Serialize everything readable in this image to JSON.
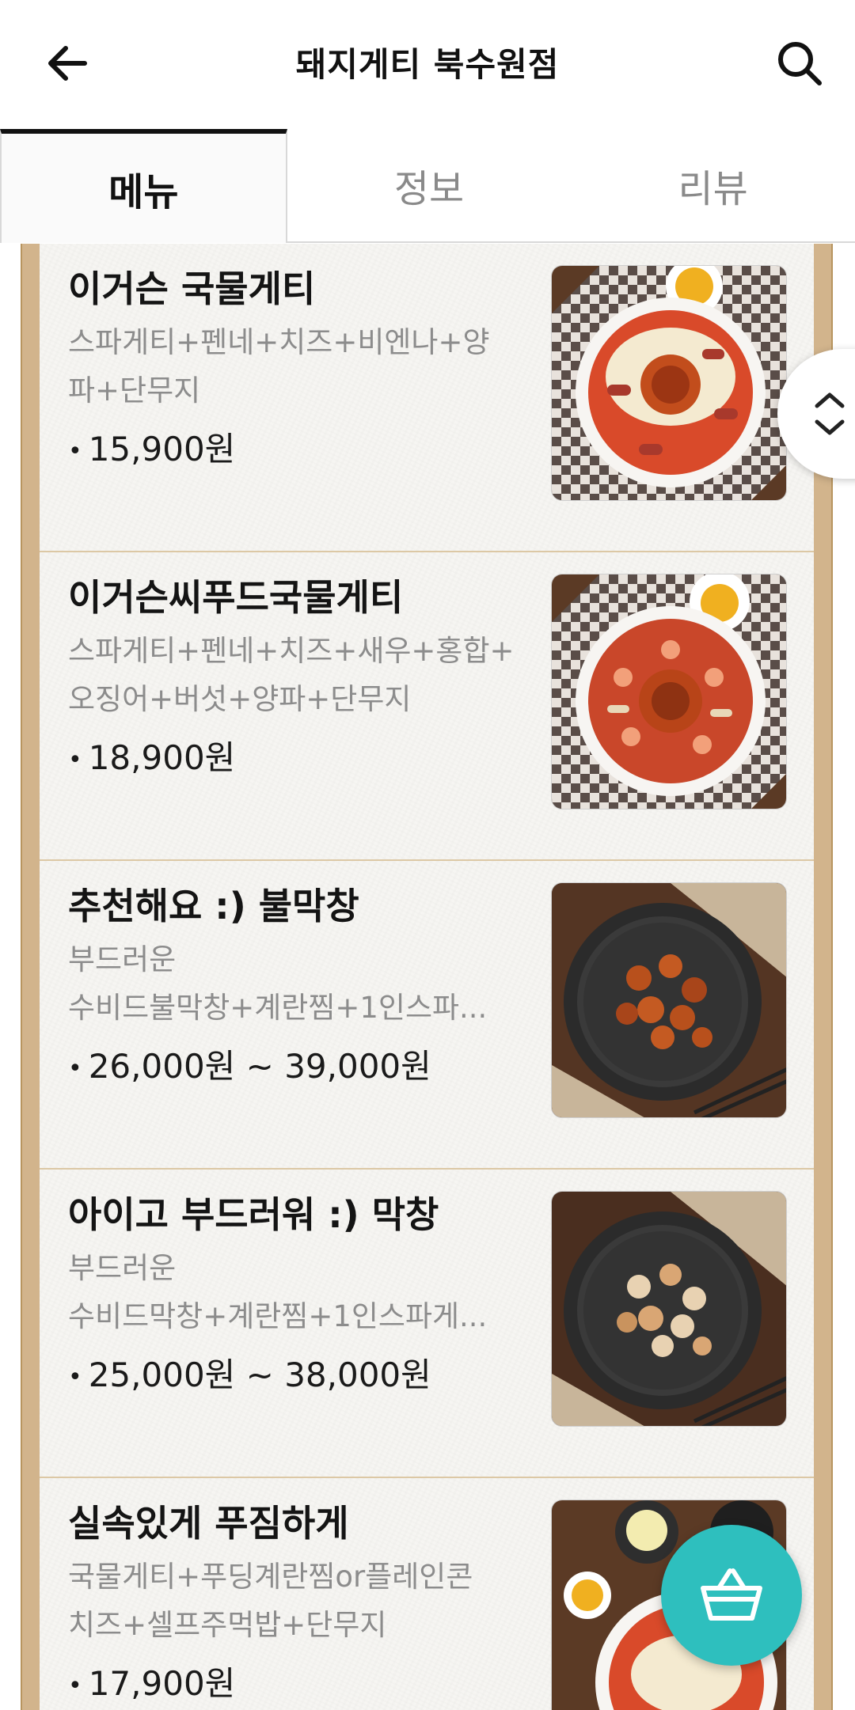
{
  "header": {
    "title": "돼지게티 북수원점",
    "back_icon": "arrow-left-icon",
    "search_icon": "search-icon"
  },
  "tabs": [
    {
      "label": "메뉴",
      "active": true
    },
    {
      "label": "정보",
      "active": false
    },
    {
      "label": "리뷰",
      "active": false
    }
  ],
  "menu_items": [
    {
      "name": "이거슨 국물게티",
      "desc_lines": [
        "스파게티+펜네+치즈+비엔나+양",
        "파+단무지"
      ],
      "price": "15,900원",
      "image": "soup-spaghetti-sausage"
    },
    {
      "name": "이거슨씨푸드국물게티",
      "desc_lines": [
        "스파게티+펜네+치즈+새우+홍합+",
        "오징어+버섯+양파+단무지"
      ],
      "price": "18,900원",
      "image": "seafood-soup-spaghetti"
    },
    {
      "name": "추천해요 :) 불막창",
      "desc_lines": [
        "부드러운",
        "수비드불막창+계란찜+1인스파..."
      ],
      "price": "26,000원 ~ 39,000원",
      "image": "spicy-makchang-pan"
    },
    {
      "name": "아이고 부드러워 :) 막창",
      "desc_lines": [
        "부드러운",
        "수비드막창+계란찜+1인스파게..."
      ],
      "price": "25,000원 ~ 38,000원",
      "image": "makchang-pan"
    },
    {
      "name": "실속있게 푸짐하게",
      "desc_lines": [
        "국물게티+푸딩계란찜or플레인콘",
        "치즈+셀프주먹밥+단무지"
      ],
      "price": "17,900원",
      "image": "combo-set"
    }
  ],
  "floating": {
    "scroll_icon": "chevron-up-down-icon",
    "cart_icon": "basket-icon"
  },
  "colors": {
    "board_frame": "#d2b48c",
    "cart_fab": "#2ebfbe",
    "active_tab_bar": "#111111"
  }
}
